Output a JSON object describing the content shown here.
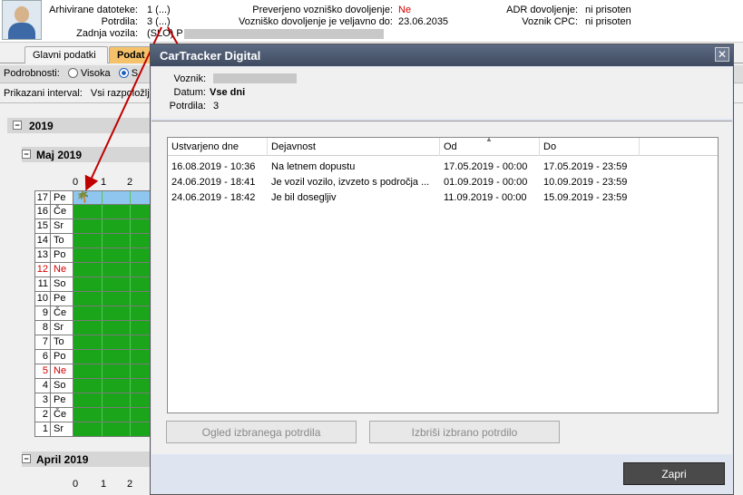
{
  "header": {
    "arch_label": "Arhivirane datoteke:",
    "arch_value": "1 (...)",
    "potrdila_label": "Potrdila:",
    "potrdila_value": "3 (...)",
    "zadnja_label": "Zadnja vozila:",
    "zadnja_value": "(SLO) P",
    "preverjeno_label": "Preverjeno vozniško dovoljenje:",
    "preverjeno_value": "Ne",
    "veljavno_label": "Vozniško dovoljenje je veljavno do:",
    "veljavno_value": "23.06.2035",
    "adr_label": "ADR dovoljenje:",
    "adr_value": "ni prisoten",
    "cpc_label": "Voznik CPC:",
    "cpc_value": "ni prisoten",
    "accent_red": "#d40000"
  },
  "tabs": [
    {
      "label": "Glavni podatki"
    },
    {
      "label": "Podat"
    }
  ],
  "details_bar": {
    "label": "Podrobnosti:",
    "opt1": "Visoka",
    "opt2": "S"
  },
  "interval_bar": {
    "label": "Prikazani interval:",
    "value": "Vsi razpoložlji"
  },
  "calendar": {
    "year": "2019",
    "month": "Maj 2019",
    "month2": "April 2019",
    "hours": [
      "0",
      "1",
      "2"
    ],
    "days": [
      {
        "d": "17",
        "w": "Pe",
        "weekend": false
      },
      {
        "d": "16",
        "w": "Če",
        "weekend": false
      },
      {
        "d": "15",
        "w": "Sr",
        "weekend": false
      },
      {
        "d": "14",
        "w": "To",
        "weekend": false
      },
      {
        "d": "13",
        "w": "Po",
        "weekend": false
      },
      {
        "d": "12",
        "w": "Ne",
        "weekend": true
      },
      {
        "d": "11",
        "w": "So",
        "weekend": false
      },
      {
        "d": "10",
        "w": "Pe",
        "weekend": false
      },
      {
        "d": "9",
        "w": "Če",
        "weekend": false
      },
      {
        "d": "8",
        "w": "Sr",
        "weekend": false
      },
      {
        "d": "7",
        "w": "To",
        "weekend": false
      },
      {
        "d": "6",
        "w": "Po",
        "weekend": false
      },
      {
        "d": "5",
        "w": "Ne",
        "weekend": true
      },
      {
        "d": "4",
        "w": "So",
        "weekend": false
      },
      {
        "d": "3",
        "w": "Pe",
        "weekend": false
      },
      {
        "d": "2",
        "w": "Če",
        "weekend": false
      },
      {
        "d": "1",
        "w": "Sr",
        "weekend": false
      }
    ],
    "activity_color": "#1aa51a",
    "holiday_color": "#8ec6f0"
  },
  "dialog": {
    "title": "CarTracker Digital",
    "voznik_label": "Voznik:",
    "datum_label": "Datum:",
    "datum_value": "Vse dni",
    "potrdila_label": "Potrdila:",
    "potrdila_value": "3",
    "columns": [
      "Ustvarjeno dne",
      "Dejavnost",
      "Od",
      "Do"
    ],
    "rows": [
      {
        "created": "16.08.2019 - 10:36",
        "activity": "Na letnem dopustu",
        "from": "17.05.2019 - 00:00",
        "to": "17.05.2019 - 23:59"
      },
      {
        "created": "24.06.2019 - 18:41",
        "activity": "Je vozil vozilo, izvzeto s področja ...",
        "from": "01.09.2019 - 00:00",
        "to": "10.09.2019 - 23:59"
      },
      {
        "created": "24.06.2019 - 18:42",
        "activity": "Je bil dosegljiv",
        "from": "11.09.2019 - 00:00",
        "to": "15.09.2019 - 23:59"
      }
    ],
    "btn_view": "Ogled izbranega potrdila",
    "btn_delete": "Izbriši izbrano potrdilo",
    "btn_close": "Zapri"
  }
}
